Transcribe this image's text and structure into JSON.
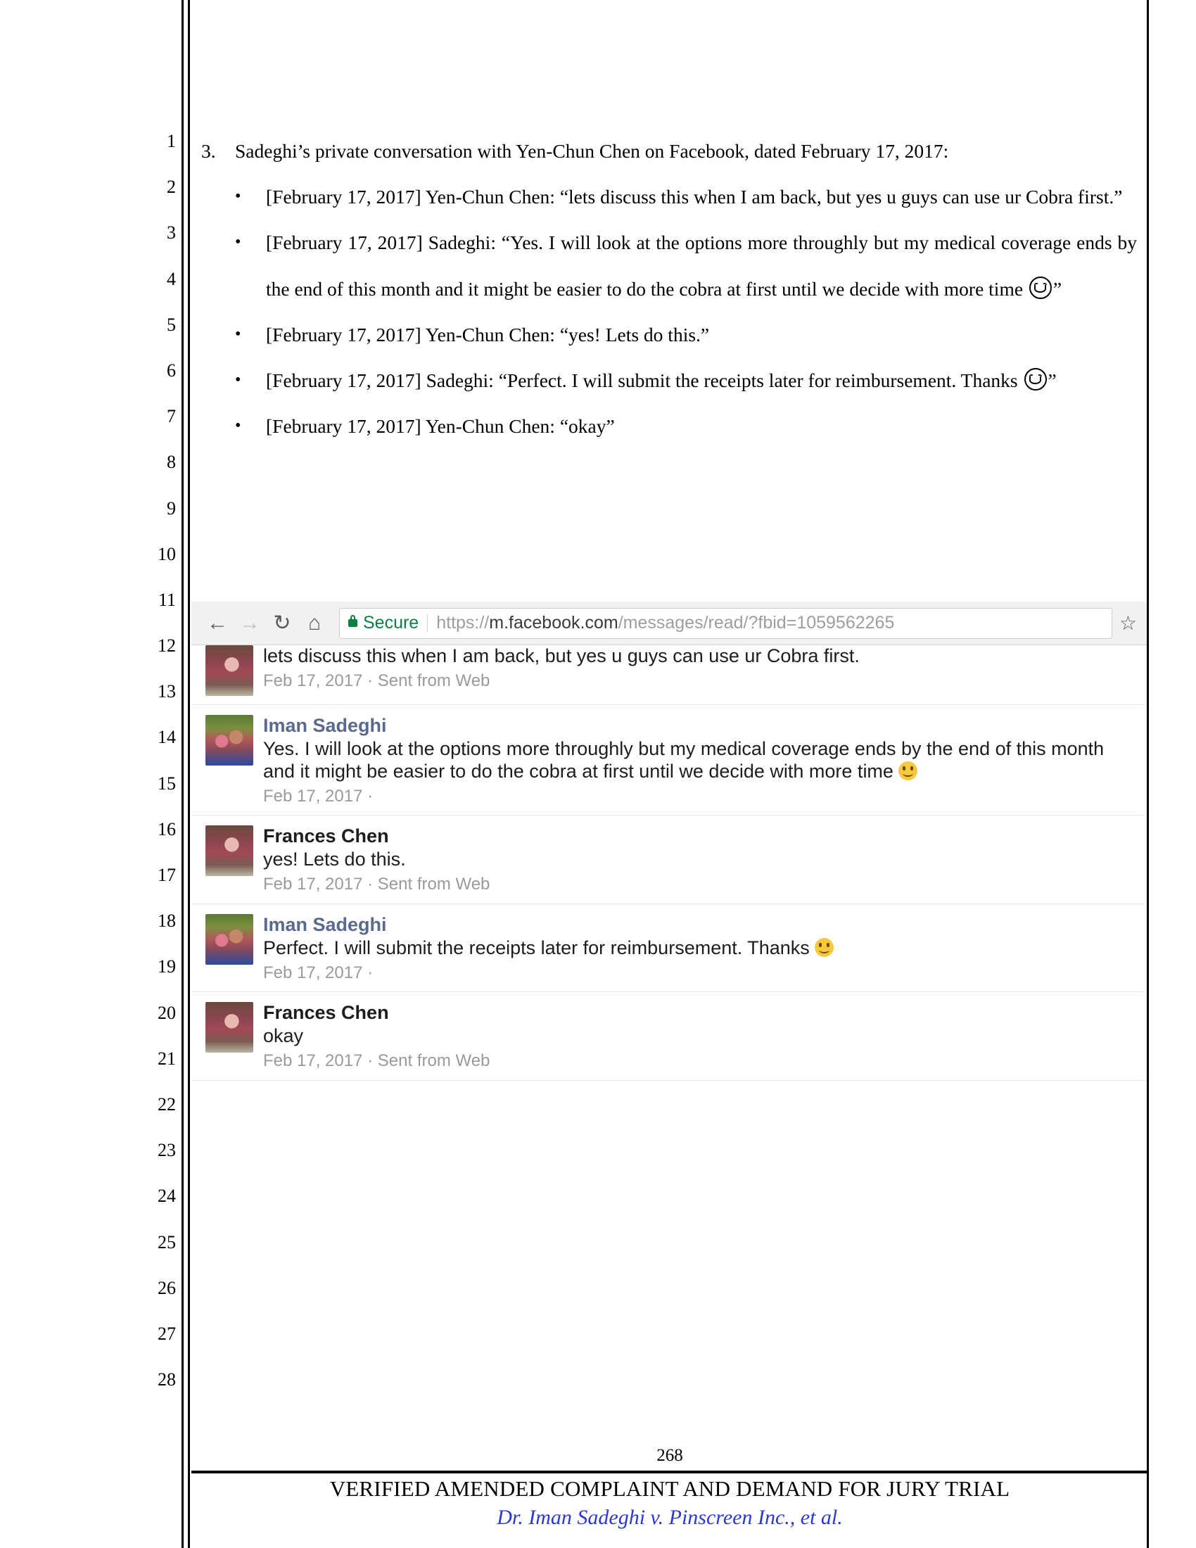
{
  "pleading": {
    "line_numbers": [
      "1",
      "2",
      "3",
      "4",
      "5",
      "6",
      "7",
      "8",
      "9",
      "10",
      "11",
      "12",
      "13",
      "14",
      "15",
      "16",
      "17",
      "18",
      "19",
      "20",
      "21",
      "22",
      "23",
      "24",
      "25",
      "26",
      "27",
      "28"
    ],
    "item_number": "3.",
    "item_text": "Sadeghi’s private conversation with Yen-Chun Chen on Facebook, dated February 17, 2017:",
    "bullets": [
      {
        "prefix": "[February 17, 2017] Yen-Chun Chen: “lets discuss this when I am back, but yes u guys can use ur Cobra first.”",
        "suffix": "",
        "emoji": false
      },
      {
        "prefix": "[February 17, 2017] Sadeghi: “Yes. I will look at the options more throughly but my medical coverage ends by the end of this month and it might be easier to do the cobra at first until we decide with more time ",
        "suffix": "”",
        "emoji": true
      },
      {
        "prefix": "[February 17, 2017] Yen-Chun Chen: “yes! Lets do this.”",
        "suffix": "",
        "emoji": false
      },
      {
        "prefix": "[February 17, 2017] Sadeghi: “Perfect. I will submit the receipts later for reimbursement. Thanks ",
        "suffix": "”",
        "emoji": true
      },
      {
        "prefix": "[February 17, 2017] Yen-Chun Chen: “okay”",
        "suffix": "",
        "emoji": false
      }
    ]
  },
  "browser": {
    "back_icon": "←",
    "forward_icon": "→",
    "reload_icon": "↻",
    "home_icon": "⌂",
    "security_label": "Secure",
    "url_scheme": "https://",
    "url_host": "m.facebook.com",
    "url_path": "/messages/read/?fbid=1059562265",
    "url_full": "https://m.facebook.com/messages/read/?fbid=1059562265",
    "bookmark_icon": "☆"
  },
  "conversation": {
    "messages": [
      {
        "sender": "",
        "sender_style": "dark",
        "text": "lets discuss this when I am back, but yes u guys can use ur Cobra first.",
        "meta": "Feb 17, 2017 · Sent from Web",
        "avatar": "frances",
        "partial": true,
        "emoji": false
      },
      {
        "sender": "Iman Sadeghi",
        "sender_style": "blue",
        "text": "Yes. I will look at the options more throughly but my medical coverage ends by the end of this month and it might be easier to do the cobra at first until we decide with more time ",
        "meta": "Feb 17, 2017 ·",
        "avatar": "iman",
        "partial": false,
        "emoji": true
      },
      {
        "sender": "Frances Chen",
        "sender_style": "dark",
        "text": "yes! Lets do this.",
        "meta": "Feb 17, 2017 · Sent from Web",
        "avatar": "frances",
        "partial": false,
        "emoji": false
      },
      {
        "sender": "Iman Sadeghi",
        "sender_style": "blue",
        "text": "Perfect. I will submit the receipts later for reimbursement. Thanks ",
        "meta": "Feb 17, 2017 ·",
        "avatar": "iman",
        "partial": false,
        "emoji": true
      },
      {
        "sender": "Frances Chen",
        "sender_style": "dark",
        "text": "okay",
        "meta": "Feb 17, 2017 · Sent from Web",
        "avatar": "frances",
        "partial": false,
        "emoji": false
      }
    ]
  },
  "footer": {
    "page_number": "268",
    "title": "VERIFIED AMENDED COMPLAINT AND DEMAND FOR JURY TRIAL",
    "case_caption": "Dr. Iman Sadeghi v. Pinscreen Inc., et al.",
    "case_color": "#2c37d6"
  }
}
